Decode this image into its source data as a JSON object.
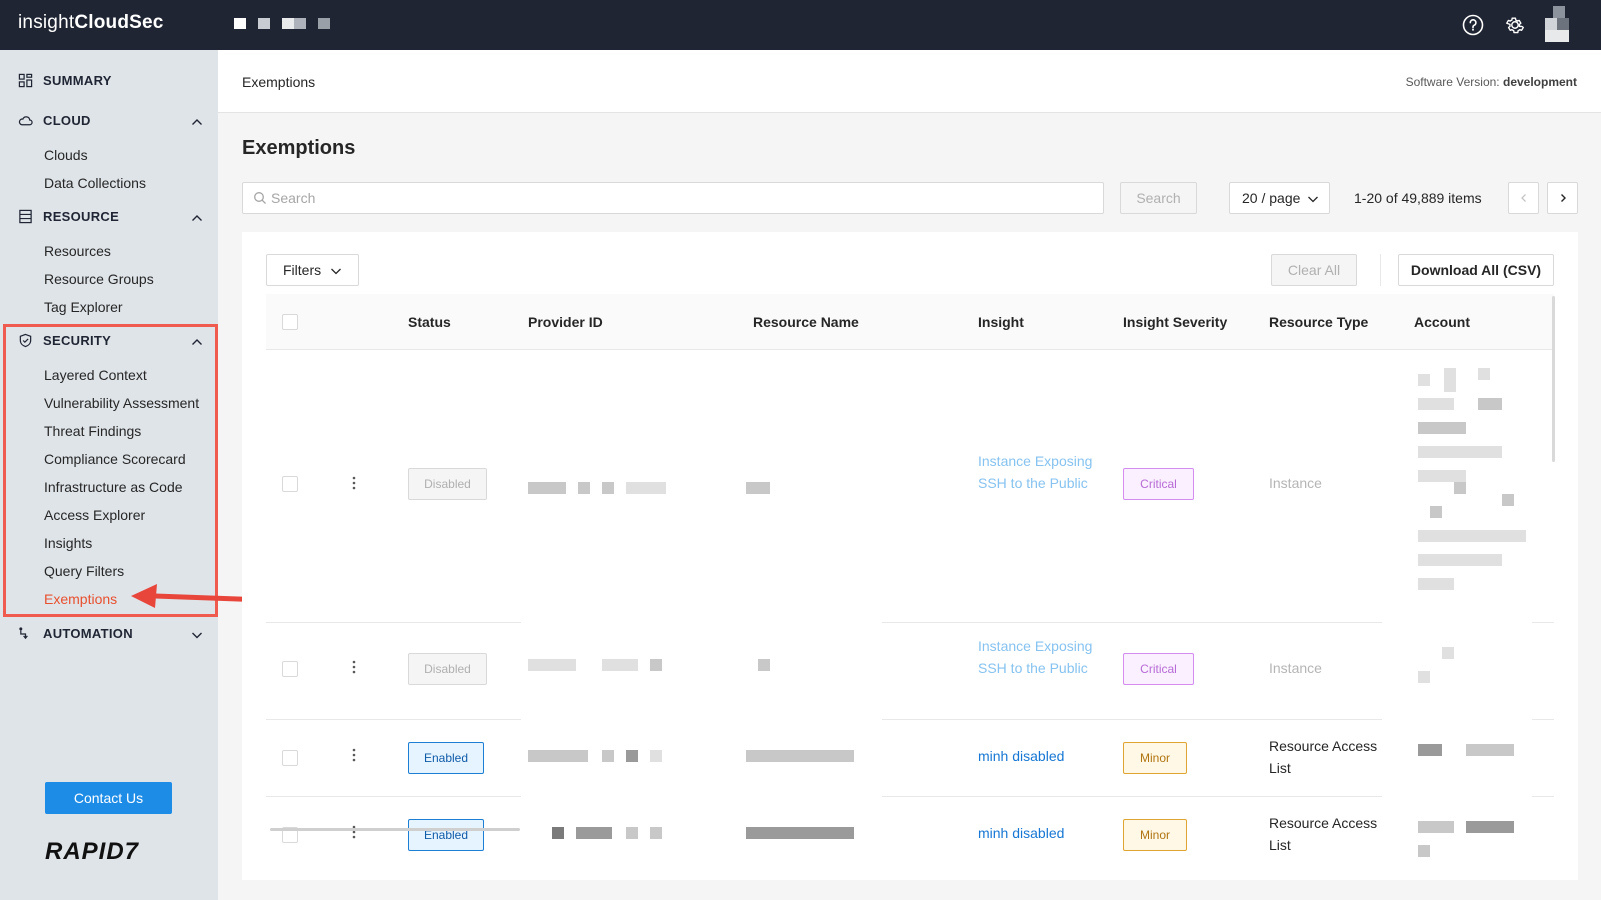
{
  "app": {
    "brand_light": "insight",
    "brand_bold": "CloudSec"
  },
  "header": {
    "breadcrumb": "Exemptions",
    "version_label": "Software Version:",
    "version_value": "development"
  },
  "sidebar": {
    "sections": {
      "summary": "SUMMARY",
      "cloud": "CLOUD",
      "resource": "RESOURCE",
      "security": "SECURITY",
      "automation": "AUTOMATION"
    },
    "cloud_items": [
      "Clouds",
      "Data Collections"
    ],
    "resource_items": [
      "Resources",
      "Resource Groups",
      "Tag Explorer"
    ],
    "security_items": [
      "Layered Context",
      "Vulnerability Assessment",
      "Threat Findings",
      "Compliance Scorecard",
      "Infrastructure as Code",
      "Access Explorer",
      "Insights",
      "Query Filters",
      "Exemptions"
    ],
    "active_item": "Exemptions",
    "contact_label": "Contact Us",
    "logo_text": "RAPID7"
  },
  "page": {
    "title": "Exemptions",
    "search_placeholder": "Search",
    "search_button": "Search",
    "page_size": "20 / page",
    "range_text": "1-20 of 49,889 items",
    "filters_label": "Filters",
    "clear_all_label": "Clear All",
    "download_label": "Download All (CSV)"
  },
  "table": {
    "columns": [
      "Status",
      "Provider ID",
      "Resource Name",
      "Insight",
      "Insight Severity",
      "Resource Type",
      "Account"
    ],
    "rows": [
      {
        "status": "Disabled",
        "insight": "Instance Exposing SSH to the Public",
        "severity": "Critical",
        "resource_type": "Instance"
      },
      {
        "status": "Disabled",
        "insight": "Instance Exposing SSH to the Public",
        "severity": "Critical",
        "resource_type": "Instance"
      },
      {
        "status": "Enabled",
        "insight": "minh disabled",
        "severity": "Minor",
        "resource_type": "Resource Access List"
      },
      {
        "status": "Enabled",
        "insight": "minh disabled",
        "severity": "Minor",
        "resource_type": "Resource Access List"
      }
    ]
  },
  "colors": {
    "topbar": "#1f2533",
    "sidebar": "#dfe4e9",
    "accent_active": "#e8502e",
    "primary_button": "#1d8ce7",
    "highlight_annotation": "#ef5b4f"
  }
}
